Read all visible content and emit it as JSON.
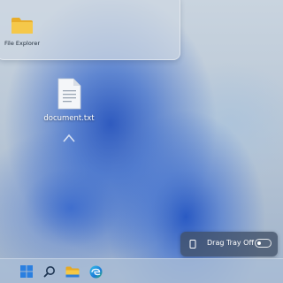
{
  "flyout": {
    "file_explorer_label": "File Explorer"
  },
  "desktop": {
    "document_label": "document.txt"
  },
  "drag_tray": {
    "label": "Drag Tray Off",
    "toggle_state": "off"
  },
  "taskbar": {
    "items": [
      "start-icon",
      "search-icon",
      "file-explorer-icon",
      "edge-icon"
    ]
  },
  "colors": {
    "folder_yellow": "#f5c342",
    "start_blue": "#1f7fe0",
    "toast_bg": "#405066"
  }
}
